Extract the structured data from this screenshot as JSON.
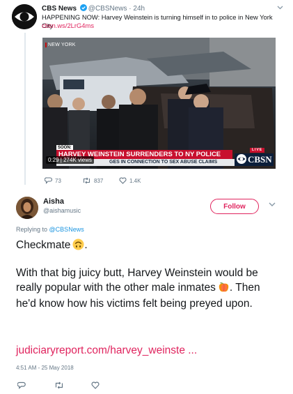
{
  "quoted_tweet": {
    "author_name": "CBS News",
    "author_handle": "@CBSNews",
    "time": "24h",
    "text": "HAPPENING NOW: Harvey Weinstein is turning himself in to police in New York City",
    "link": "cbsn.ws/2LrG4ms",
    "video": {
      "location_tag": "NEW YORK",
      "soon_tag": "SOON:",
      "banner": "HARVEY WEINSTEIN SURRENDERS TO NY POLICE",
      "subbanner": "GES IN CONNECTION TO SEX ABUSE CLAIMS",
      "live_tag": "LIVE",
      "network": "CBSN",
      "time_views": "0:29 | 274K views"
    },
    "actions": {
      "replies": "73",
      "retweets": "837",
      "likes": "1.4K"
    },
    "icons": {
      "avatar": "cbs-eye-logo-icon",
      "verified": "verified-badge-icon",
      "caret": "chevron-down-icon",
      "reply": "reply-icon",
      "retweet": "retweet-icon",
      "like": "heart-icon"
    }
  },
  "tweet": {
    "author_name": "Aisha",
    "author_handle": "@aishamusic",
    "follow_label": "Follow",
    "reply_prefix": "Replying to",
    "reply_to": "@CBSNews",
    "line1": "Checkmate",
    "line2_a": "With that big juicy butt, Harvey Weinstein would be really popular with the other male inmates",
    "line2_b": ". Then he'd know how his victims felt being preyed upon.",
    "link": "judiciaryreport.com/harvey_weinste  ...",
    "timestamp": "4:51 AM - 25 May 2018",
    "icons": {
      "emoji_1": "upside-down-face-emoji-icon",
      "emoji_2": "peach-emoji-icon",
      "caret": "chevron-down-icon",
      "reply": "reply-icon",
      "retweet": "retweet-icon",
      "like": "heart-icon"
    }
  },
  "colors": {
    "accent_link": "#e0245e",
    "blue_link": "#1b95e0",
    "secondary_text": "#657786",
    "banner_red": "#c8102e"
  }
}
